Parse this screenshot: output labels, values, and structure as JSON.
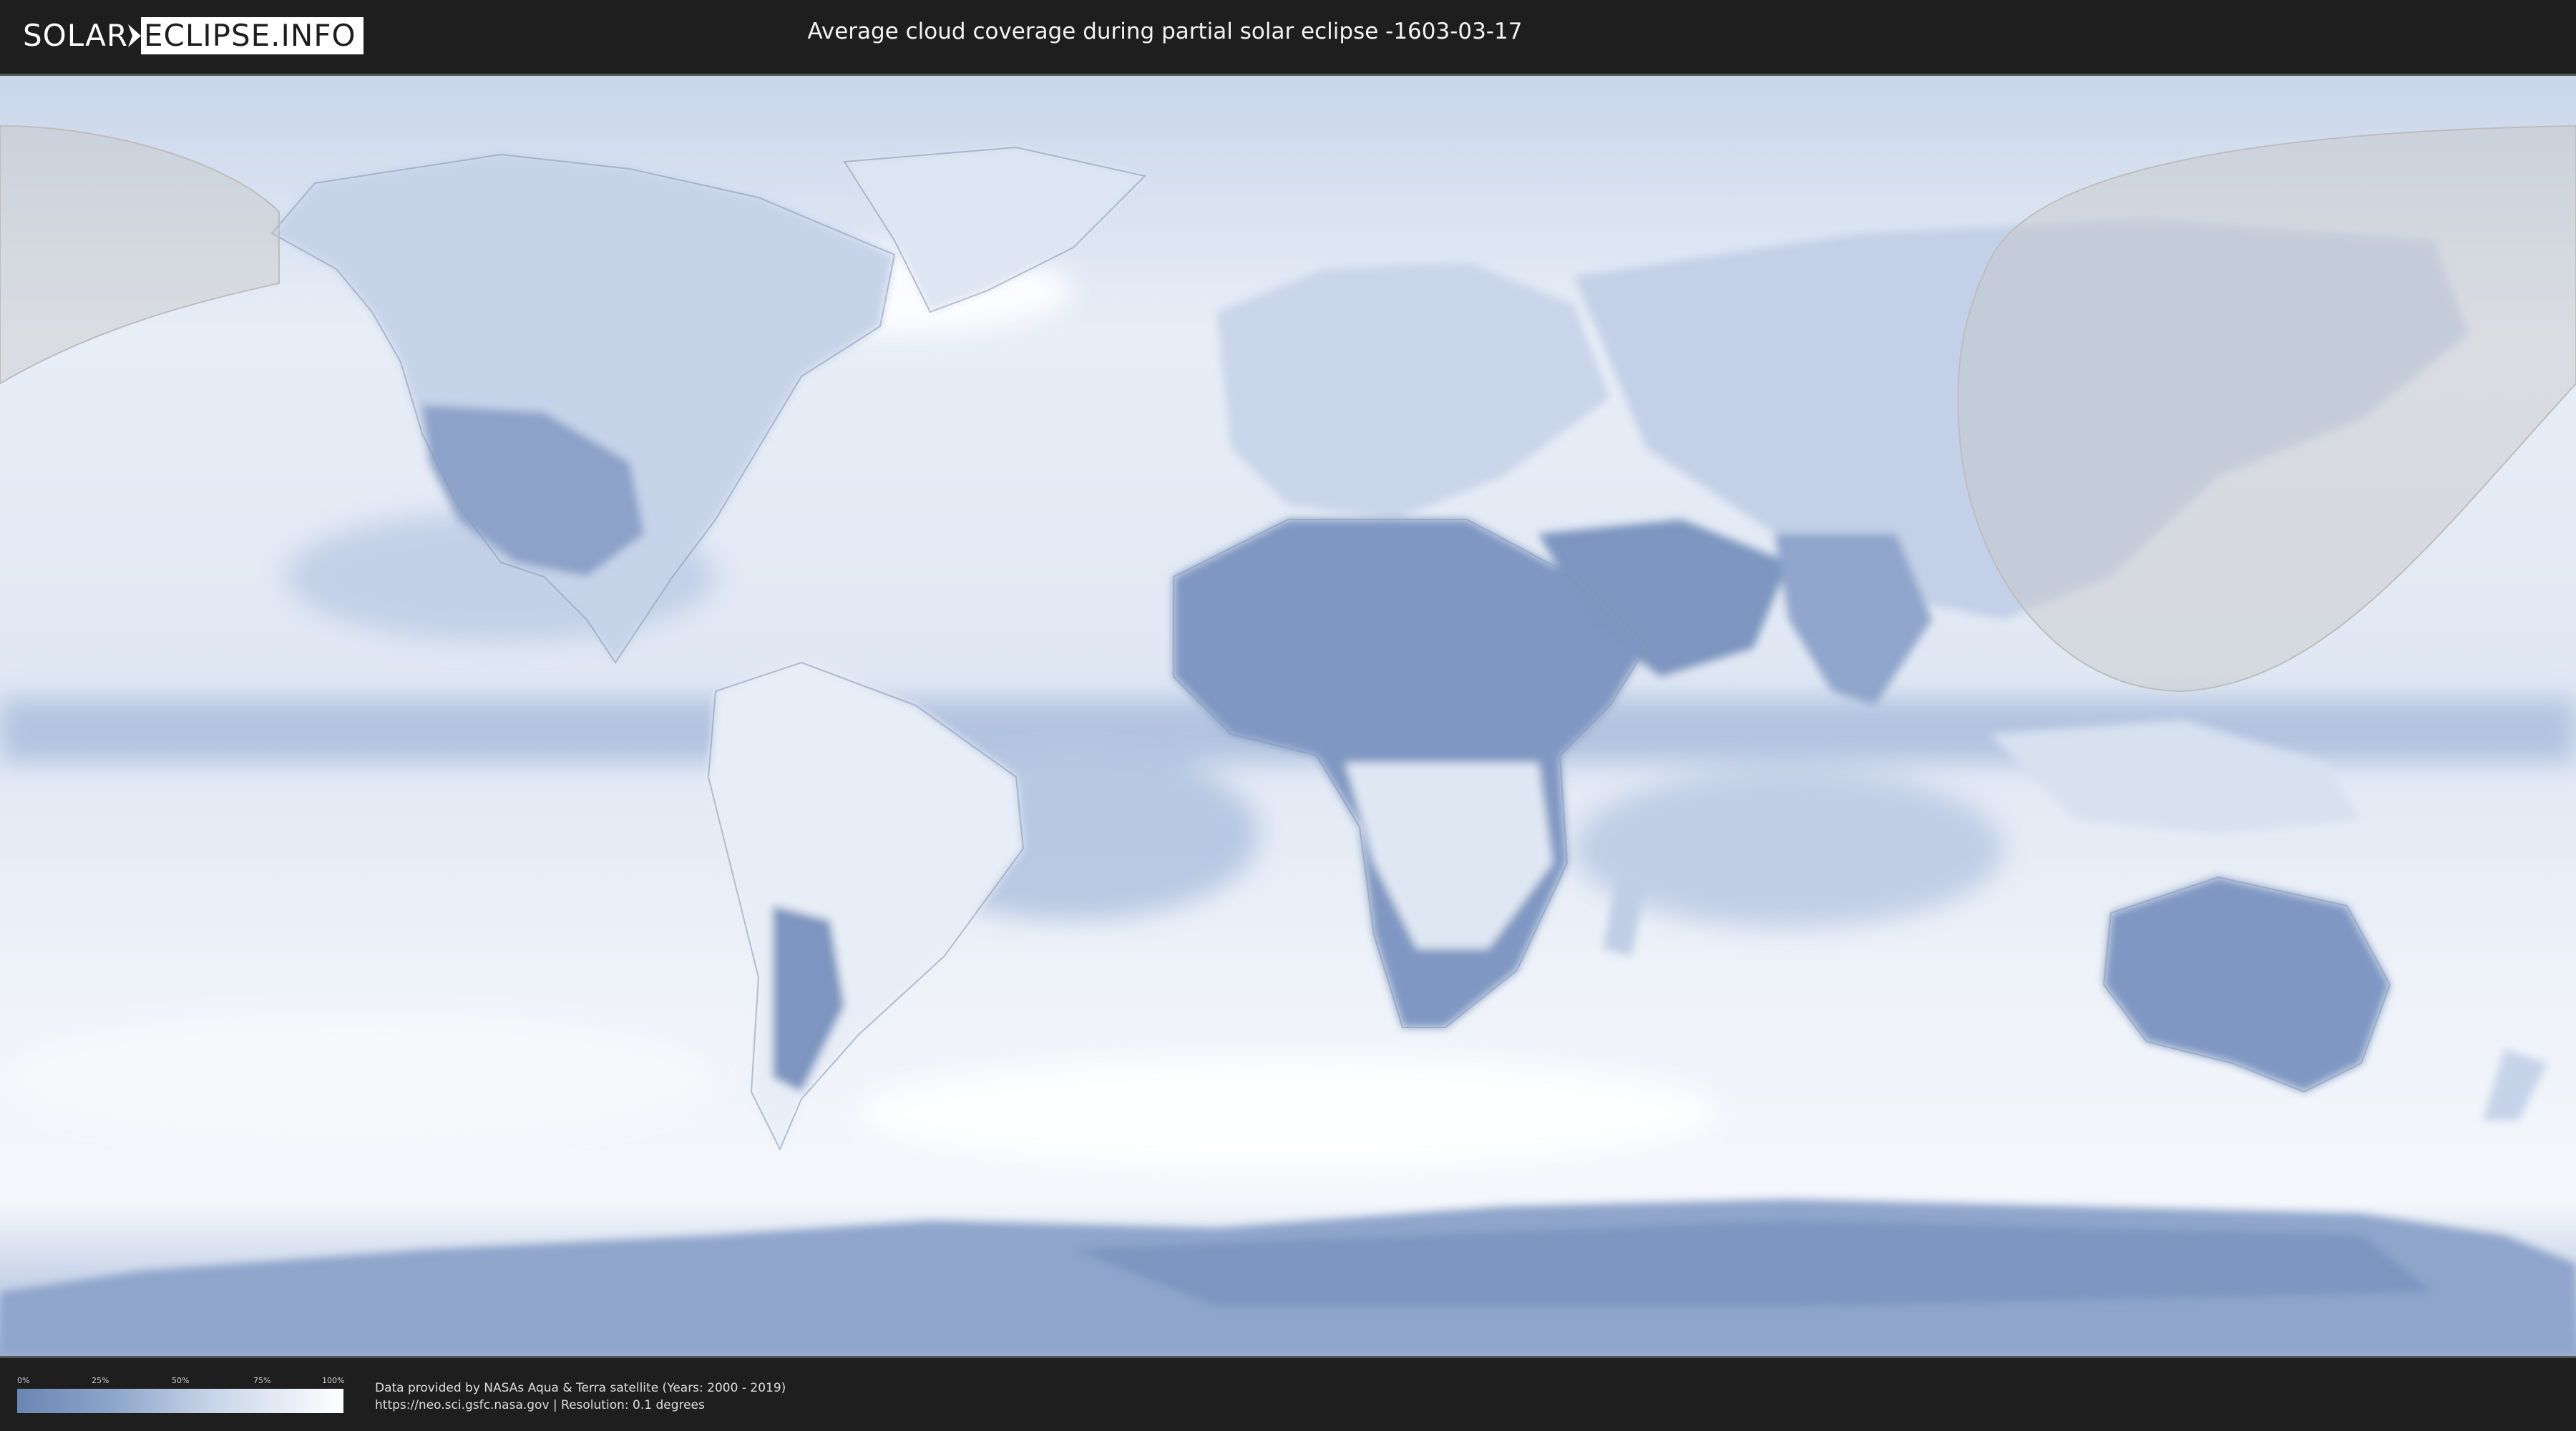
{
  "header": {
    "logo_left": "SOLAR",
    "logo_right": "ECLIPSE.INFO",
    "title": "Average cloud coverage during partial solar eclipse -1603-03-17"
  },
  "legend": {
    "ticks": [
      "0%",
      "25%",
      "50%",
      "75%",
      "100%"
    ],
    "colors": {
      "low": "#6b85b4",
      "high": "#ffffff"
    }
  },
  "credits": {
    "line1": "Data provided by NASAs Aqua & Terra satellite (Years: 2000 - 2019)",
    "line2": "https://neo.sci.gsfc.nasa.gov | Resolution: 0.1 degrees"
  },
  "colors": {
    "background": "#1e1e1e",
    "ocean_cloud": "#dfe7f2",
    "land_clear": "#7f97c2",
    "eclipse_zone": "#d9d9d9"
  }
}
